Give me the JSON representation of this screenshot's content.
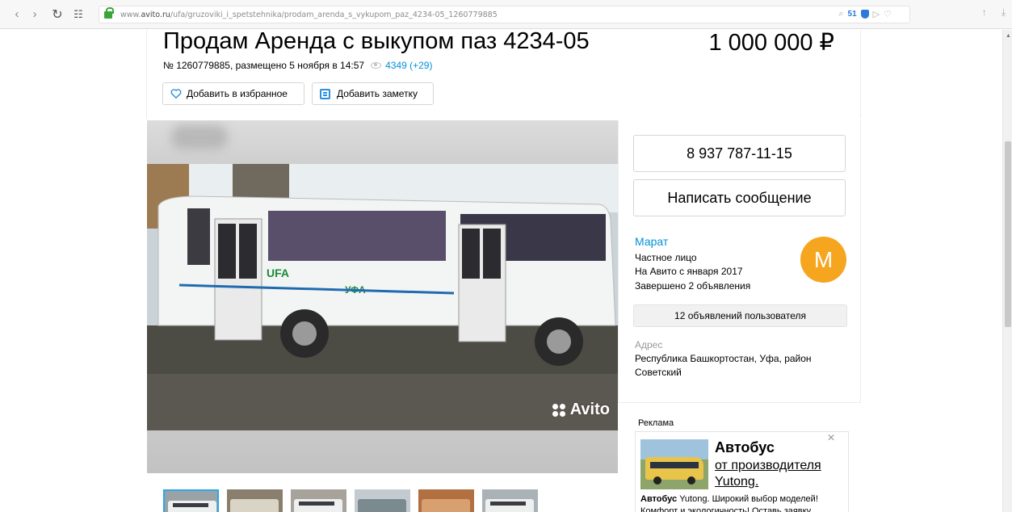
{
  "browser": {
    "url_prefix": "www.",
    "url_domain": "avito.ru",
    "url_path": "/ufa/gruzoviki_i_spetstehnika/prodam_arenda_s_vykupom_paz_4234-05_1260779885",
    "extension_count": "51"
  },
  "listing": {
    "title": "Продам Аренда с выкупом паз 4234-05",
    "price": "1 000 000 ₽",
    "meta": "№ 1260779885, размещено 5 ноября в 14:57",
    "views": "4349 (+29)",
    "fav_label": "Добавить в избранное",
    "note_label": "Добавить заметку",
    "watermark": "Avito"
  },
  "contact": {
    "phone": "8 937 787-11-15",
    "message_label": "Написать сообщение",
    "seller_name": "Марат",
    "seller_type": "Частное лицо",
    "seller_since": "На Авито с января 2017",
    "seller_completed": "Завершено 2 объявления",
    "avatar_letter": "М",
    "all_ads_label": "12 объявлений пользователя",
    "address_label": "Адрес",
    "address": "Республика Башкортостан, Уфа, район Советский"
  },
  "ad": {
    "label": "Реклама",
    "title": "Автобус",
    "subtitle_1": "от производителя",
    "subtitle_2": "Yutong.",
    "text_bold": "Автобус",
    "text": " Yutong. Широкий выбор моделей! Комфорт и экологичность! Оставь заявку"
  },
  "colors": {
    "link": "#0091d9",
    "avatar": "#f6a51e",
    "thumb_active": "#2ba7ea"
  }
}
